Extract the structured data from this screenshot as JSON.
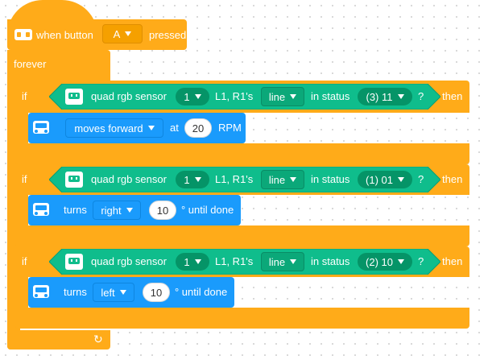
{
  "hat": {
    "label_prefix": "when button",
    "button_value": "A",
    "label_suffix": "pressed"
  },
  "forever": {
    "label": "forever"
  },
  "if_blocks": [
    {
      "if_label": "if",
      "sensor_label": "quad rgb sensor",
      "sensor_index": "1",
      "probes_label": "L1, R1's",
      "mode": "line",
      "status_label": "in status",
      "status_value": "(3) 11",
      "question": "?",
      "then_label": "then",
      "action": {
        "type": "move",
        "direction": "moves forward",
        "at_label": "at",
        "speed": "20",
        "unit": "RPM"
      }
    },
    {
      "if_label": "if",
      "sensor_label": "quad rgb sensor",
      "sensor_index": "1",
      "probes_label": "L1, R1's",
      "mode": "line",
      "status_label": "in status",
      "status_value": "(1) 01",
      "question": "?",
      "then_label": "then",
      "action": {
        "type": "turn",
        "turns_label": "turns",
        "direction": "right",
        "degrees": "10",
        "suffix": "° until done"
      }
    },
    {
      "if_label": "if",
      "sensor_label": "quad rgb sensor",
      "sensor_index": "1",
      "probes_label": "L1, R1's",
      "mode": "line",
      "status_label": "in status",
      "status_value": "(2) 10",
      "question": "?",
      "then_label": "then",
      "action": {
        "type": "turn",
        "turns_label": "turns",
        "direction": "left",
        "degrees": "10",
        "suffix": "° until done"
      }
    }
  ],
  "colors": {
    "control": "#ffab19",
    "sensing": "#0fbd8c",
    "motion": "#1a9bfc"
  },
  "icons": {
    "hat": "button-board-icon",
    "sensor": "rgb-sensor-icon",
    "action": "robot-icon",
    "loop": "loop-arrow-icon"
  }
}
